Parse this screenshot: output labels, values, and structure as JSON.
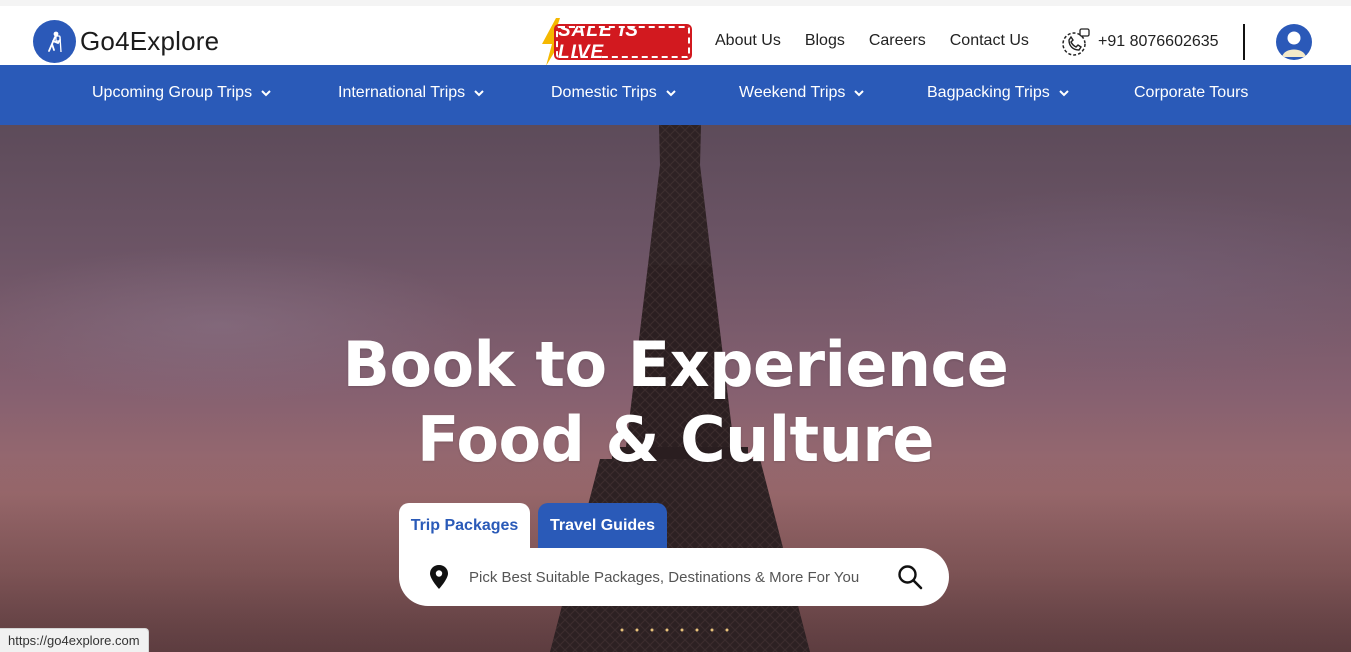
{
  "header": {
    "logo_text": "Go4Explore",
    "sale_badge": "SALE IS LIVE",
    "links": [
      "About Us",
      "Blogs",
      "Careers",
      "Contact Us"
    ],
    "phone": "+91 8076602635"
  },
  "nav": {
    "items": [
      {
        "label": "Upcoming Group Trips",
        "dropdown": true
      },
      {
        "label": "International Trips",
        "dropdown": true
      },
      {
        "label": "Domestic Trips",
        "dropdown": true
      },
      {
        "label": "Weekend Trips",
        "dropdown": true
      },
      {
        "label": "Bagpacking Trips",
        "dropdown": true
      },
      {
        "label": "Corporate Tours",
        "dropdown": false
      }
    ]
  },
  "hero": {
    "headline_line1": "Book to Experience",
    "headline_line2": "Food & Culture",
    "tabs": [
      "Trip Packages",
      "Travel Guides"
    ],
    "search_placeholder": "Pick Best Suitable Packages, Destinations & More For You"
  },
  "status_bar": {
    "url": "https://go4explore.com"
  },
  "colors": {
    "brand_blue": "#2a5ab8",
    "sale_red": "#d2191f"
  }
}
